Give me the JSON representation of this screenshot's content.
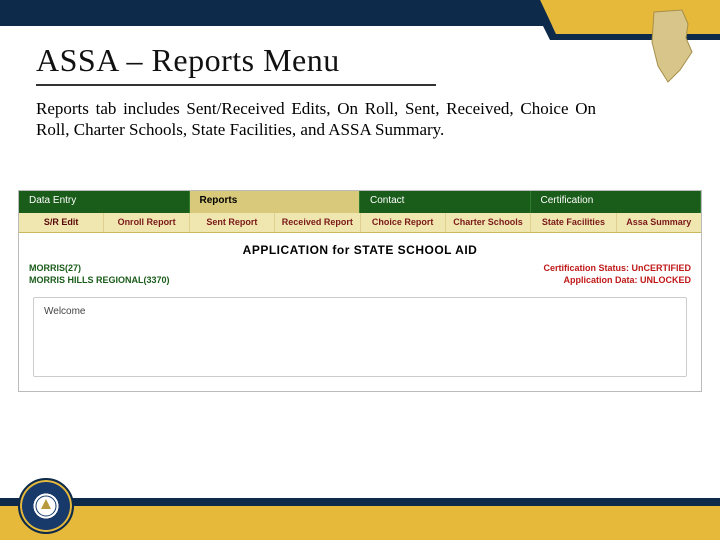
{
  "header": {
    "title": "ASSA – Reports Menu",
    "description": "Reports tab includes Sent/Received Edits, On Roll, Sent, Received, Choice On Roll, Charter Schools, State Facilities, and ASSA Summary."
  },
  "mainTabs": [
    "Data Entry",
    "Reports",
    "Contact",
    "Certification"
  ],
  "subTabs": [
    "S/R Edit",
    "Onroll Report",
    "Sent Report",
    "Received Report",
    "Choice Report",
    "Charter Schools",
    "State Facilities",
    "Assa Summary"
  ],
  "application": {
    "title": "APPLICATION for STATE SCHOOL AID",
    "county": "MORRIS(27)",
    "district": "MORRIS HILLS REGIONAL(3370)",
    "certStatus": "Certification Status: UnCERTIFIED",
    "appData": "Application Data: UNLOCKED",
    "welcome": "Welcome"
  }
}
